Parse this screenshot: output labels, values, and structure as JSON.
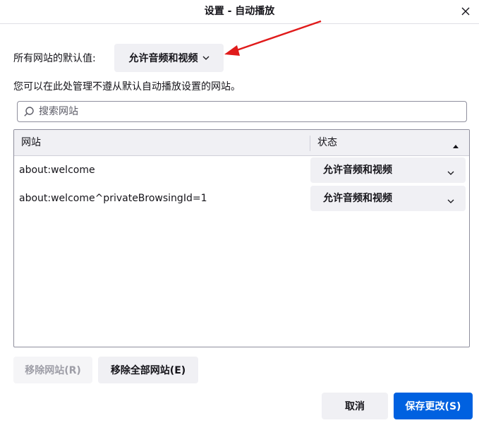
{
  "window": {
    "title": "设置 - 自动播放"
  },
  "default_setting": {
    "label": "所有网站的默认值:",
    "selected": "允许音频和视频"
  },
  "description": "您可以在此处管理不遵从默认自动播放设置的网站。",
  "search": {
    "placeholder": "搜索网站",
    "value": ""
  },
  "table": {
    "columns": {
      "site": "网站",
      "status": "状态"
    },
    "sort": "status-descending",
    "rows": [
      {
        "site": "about:welcome",
        "status": "允许音频和视频"
      },
      {
        "site": "about:welcome^privateBrowsingId=1",
        "status": "允许音频和视频"
      }
    ]
  },
  "buttons": {
    "remove": "移除网站(R)",
    "remove_all": "移除全部网站(E)",
    "cancel": "取消",
    "save": "保存更改(S)"
  },
  "colors": {
    "accent": "#0061e0",
    "annotation_arrow": "#e01b1b",
    "button_bg": "#f0f0f4"
  },
  "icons": {
    "close": "close-icon",
    "search": "search-icon",
    "dropdown": "chevron-down-icon",
    "sort": "sort-up-icon"
  }
}
